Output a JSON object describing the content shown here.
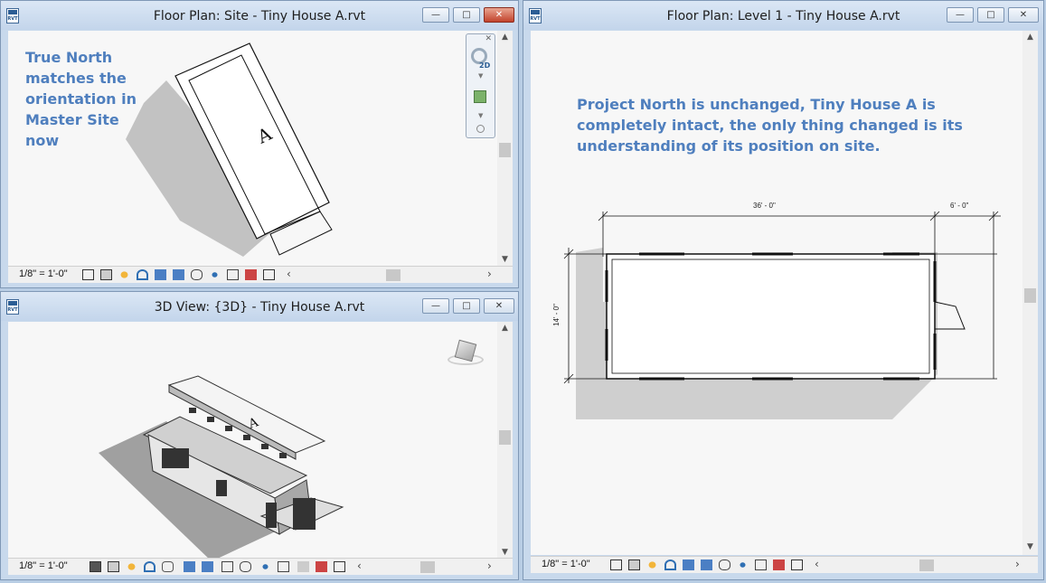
{
  "windows": {
    "site": {
      "title": "Floor Plan: Site - Tiny House A.rvt",
      "scale": "1/8\" = 1'-0\"",
      "annotation": [
        "True North",
        "matches the",
        "orientation in",
        "Master Site",
        "now"
      ],
      "house_label": "A",
      "nav_bar_label": "2D"
    },
    "view3d": {
      "title": "3D View: {3D} - Tiny House A.rvt",
      "scale": "1/8\" = 1'-0\""
    },
    "level1": {
      "title": "Floor Plan: Level 1 - Tiny House A.rvt",
      "scale": "1/8\" = 1'-0\"",
      "annotation": [
        "Project North is unchanged, Tiny House A is",
        "completely intact, the only thing changed is its",
        "understanding of its position on site."
      ],
      "dimensions": {
        "length": "36' - 0\"",
        "porch": "6' - 0\"",
        "width": "14' - 0\""
      }
    }
  },
  "icon_file": "RVT",
  "controls": {
    "minimize": "—",
    "maximize": "□",
    "close": "✕"
  },
  "colors": {
    "annotation": "#4f7fbe",
    "close_active": "#c2432c",
    "canvas": "#f7f7f7"
  }
}
